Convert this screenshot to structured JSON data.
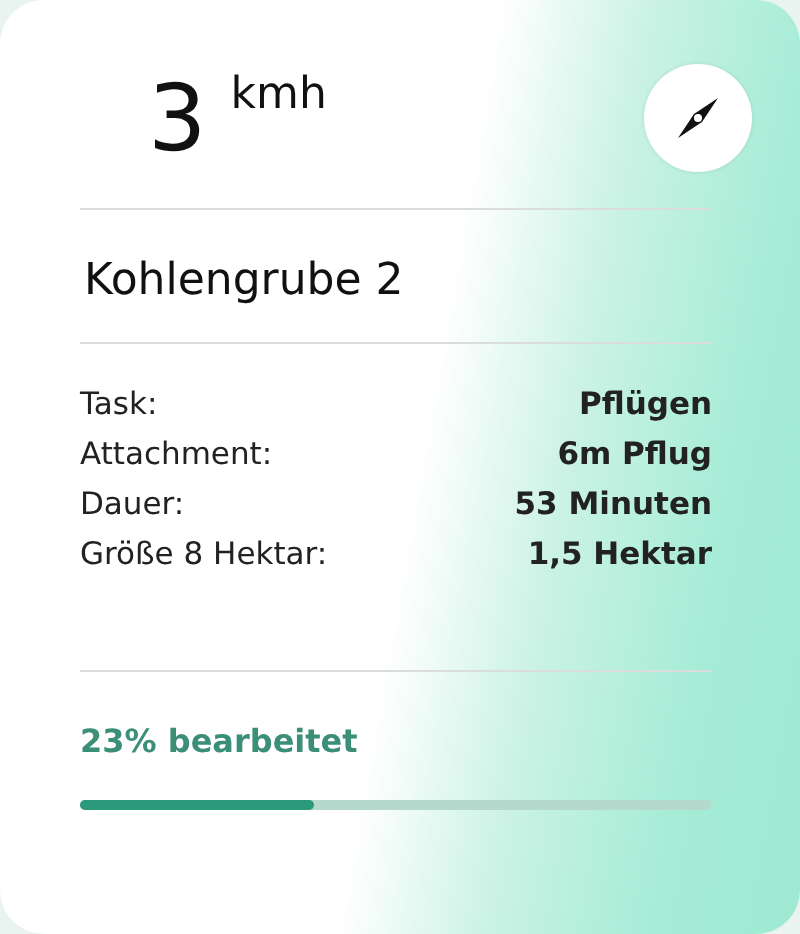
{
  "speed": {
    "value": "3",
    "unit": "kmh"
  },
  "title": "Kohlengrube 2",
  "details": [
    {
      "label": "Task:",
      "value": "Pflügen"
    },
    {
      "label": "Attachment:",
      "value": "6m Pflug"
    },
    {
      "label": "Dauer:",
      "value": "53 Minuten"
    },
    {
      "label": "Größe 8 Hektar:",
      "value": "1,5 Hektar"
    }
  ],
  "progress": {
    "text": "23% bearbeitet",
    "level": 0.37
  }
}
